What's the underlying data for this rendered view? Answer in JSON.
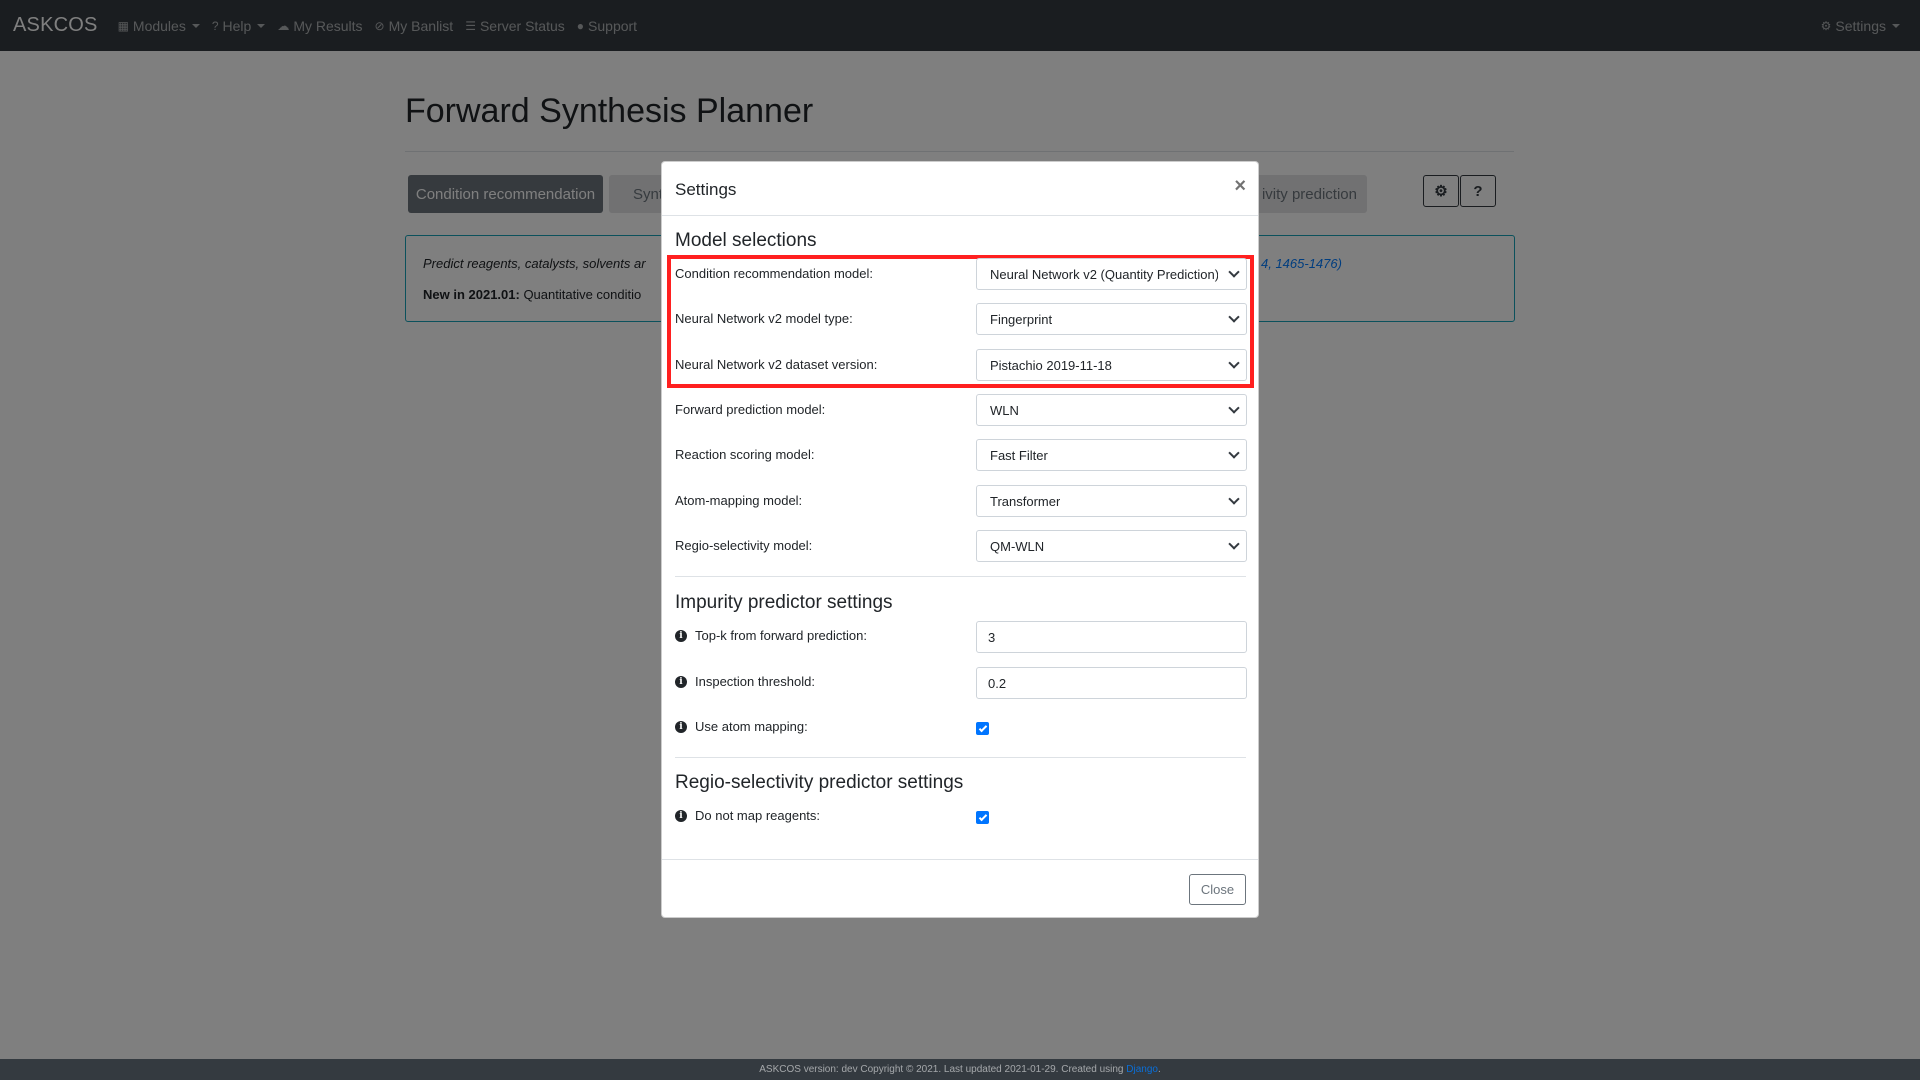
{
  "navbar": {
    "brand": "ASKCOS",
    "items": [
      {
        "label": "Modules",
        "icon": "grid-icon",
        "dropdown": true
      },
      {
        "label": "Help",
        "icon": "question-circle-icon",
        "dropdown": true
      },
      {
        "label": "My Results",
        "icon": "cloud-icon",
        "dropdown": false
      },
      {
        "label": "My Banlist",
        "icon": "ban-icon",
        "dropdown": false
      },
      {
        "label": "Server Status",
        "icon": "server-icon",
        "dropdown": false
      },
      {
        "label": "Support",
        "icon": "comment-icon",
        "dropdown": false
      }
    ],
    "settings_label": "Settings"
  },
  "page": {
    "title": "Forward Synthesis Planner",
    "tabs": {
      "active": "Condition recommendation",
      "second_partial": "Synt",
      "third_partial": "ivity prediction"
    },
    "settings_button": "⚙",
    "help_button": "?",
    "info": {
      "line1": "Predict reagents, catalysts, solvents ar",
      "reference_partial": "4, 1465-1476)",
      "line2_bold": "New in 2021.01:",
      "line2_text": " Quantitative conditio"
    }
  },
  "modal": {
    "title": "Settings",
    "close_x": "×",
    "sections": {
      "model_selections": "Model selections",
      "impurity": "Impurity predictor settings",
      "regio": "Regio-selectivity predictor settings"
    },
    "models": {
      "condition_label": "Condition recommendation model:",
      "condition_value": "Neural Network v2 (Quantity Prediction)",
      "nn_type_label": "Neural Network v2 model type:",
      "nn_type_value": "Fingerprint",
      "nn_dataset_label": "Neural Network v2 dataset version:",
      "nn_dataset_value": "Pistachio 2019-11-18",
      "forward_label": "Forward prediction model:",
      "forward_value": "WLN",
      "scoring_label": "Reaction scoring model:",
      "scoring_value": "Fast Filter",
      "atom_mapping_label": "Atom-mapping model:",
      "atom_mapping_value": "Transformer",
      "regio_label": "Regio-selectivity model:",
      "regio_value": "QM-WLN"
    },
    "impurity": {
      "topk_label": "Top-k from forward prediction:",
      "topk_value": "3",
      "threshold_label": "Inspection threshold:",
      "threshold_value": "0.2",
      "use_mapping_label": "Use atom mapping:",
      "use_mapping_checked": true
    },
    "regio_settings": {
      "no_map_label": "Do not map reagents:",
      "no_map_checked": true
    },
    "close_button": "Close"
  },
  "footer": {
    "text": "ASKCOS version: dev Copyright © 2021. Last updated 2021-01-29. Created using ",
    "link": "Django",
    "end": "."
  },
  "colors": {
    "navbar": "#343a40",
    "highlight": "#ff2020",
    "info_border": "#17a2b8",
    "checkbox": "#0075ff"
  }
}
